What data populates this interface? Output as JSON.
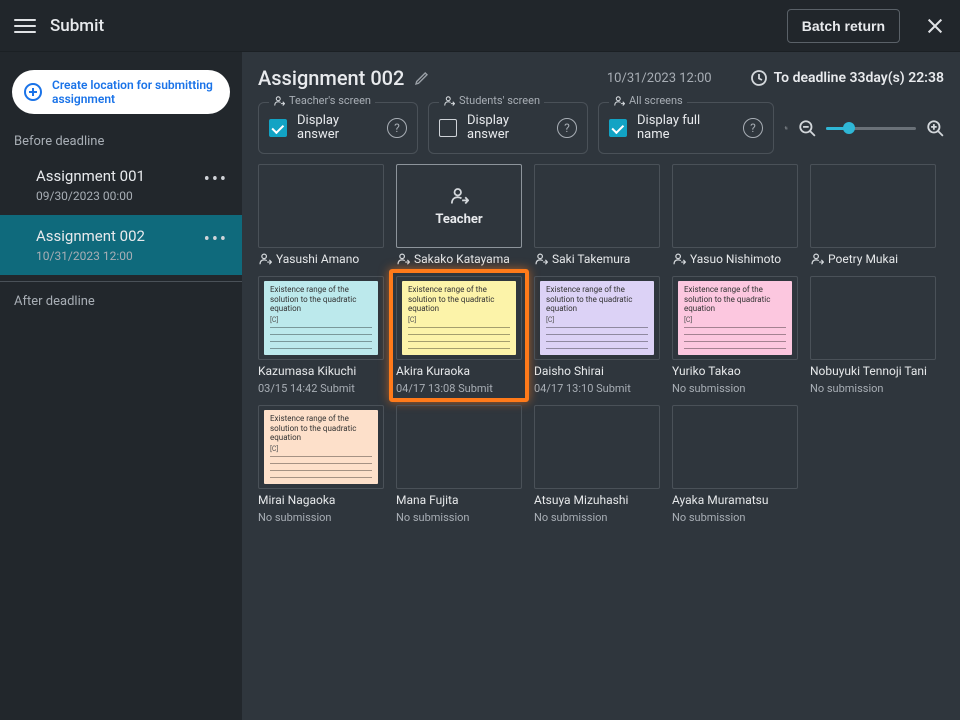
{
  "topbar": {
    "title": "Submit",
    "batch_return": "Batch return"
  },
  "sidebar": {
    "create_label": "Create location for submitting assignment",
    "before_label": "Before deadline",
    "after_label": "After deadline",
    "items": [
      {
        "name": "Assignment 001",
        "date": "09/30/2023 00:00",
        "selected": false
      },
      {
        "name": "Assignment 002",
        "date": "10/31/2023 12:00",
        "selected": true
      }
    ]
  },
  "header": {
    "title": "Assignment 002",
    "deadline_date": "10/31/2023 12:00",
    "countdown": "To deadline 33day(s) 22:38"
  },
  "controls": {
    "teacher": {
      "legend": "Teacher's screen",
      "label": "Display answer",
      "checked": true
    },
    "students": {
      "legend": "Students' screen",
      "label": "Display answer",
      "checked": false
    },
    "all": {
      "legend": "All screens",
      "label": "Display full name",
      "checked": true
    }
  },
  "teacher_tile_label": "Teacher",
  "note_text": "Existence range of the solution to the quadratic equation",
  "row1": [
    {
      "name": "Yasushi Amano",
      "type": "blank"
    },
    {
      "name": "Sakako Katayama",
      "type": "teacher"
    },
    {
      "name": "Saki Takemura",
      "type": "blank"
    },
    {
      "name": "Yasuo Nishimoto",
      "type": "blank"
    },
    {
      "name": "Poetry Mukai",
      "type": "blank"
    }
  ],
  "row2": [
    {
      "name": "Kazumasa Kikuchi",
      "sub": "03/15 14:42 Submit",
      "type": "note",
      "color": "cyan"
    },
    {
      "name": "Akira Kuraoka",
      "sub": "04/17 13:08 Submit",
      "type": "note",
      "color": "yellow",
      "highlight": true
    },
    {
      "name": "Daisho Shirai",
      "sub": "04/17 13:10 Submit",
      "type": "note",
      "color": "purple"
    },
    {
      "name": "Yuriko Takao",
      "sub": "No submission",
      "type": "note",
      "color": "pink"
    },
    {
      "name": "Nobuyuki Tennoji Tani",
      "sub": "No submission",
      "type": "blank"
    }
  ],
  "row3": [
    {
      "name": "Mirai Nagaoka",
      "sub": "No submission",
      "type": "note",
      "color": "peach"
    },
    {
      "name": "Mana Fujita",
      "sub": "No submission",
      "type": "blank"
    },
    {
      "name": "Atsuya Mizuhashi",
      "sub": "No submission",
      "type": "blank"
    },
    {
      "name": "Ayaka Muramatsu",
      "sub": "No submission",
      "type": "blank"
    }
  ]
}
